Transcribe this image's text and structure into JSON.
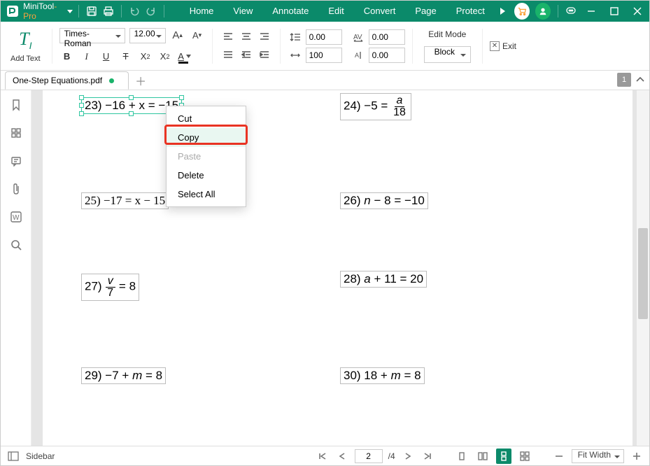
{
  "app": {
    "name_main": "MiniTool",
    "name_suffix": "-Pro"
  },
  "menu": {
    "home": "Home",
    "view": "View",
    "annotate": "Annotate",
    "edit": "Edit",
    "convert": "Convert",
    "page": "Page",
    "protect": "Protect"
  },
  "ribbon": {
    "add_text": "Add Text",
    "font_name": "Times-Roman",
    "font_size": "12.00",
    "bold": "B",
    "italic": "I",
    "underline": "U",
    "strike": "T",
    "super": "X",
    "sub": "X",
    "line_sp": "0.00",
    "char_sp": "0.00",
    "scale_h": "100",
    "scale_v": "0.00",
    "edit_mode": "Edit Mode",
    "block": "Block",
    "exit": "Exit"
  },
  "tab": {
    "filename": "One-Step Equations.pdf",
    "page_badge": "1"
  },
  "equations": {
    "q23": "23)  −16 + x = −15",
    "q24_pre": "24)  −5 = ",
    "q24_num": "a",
    "q24_den": "18",
    "q25": "25)  −17 = x − 15",
    "q26": "26)   n − 8 = −10",
    "q27_pre": "27)  ",
    "q27_num": "v",
    "q27_den": "7",
    "q27_post": " = 8",
    "q28": "28)   a + 11 = 20",
    "q29": "29)  −7 + m = 8",
    "q30": "30)   18 + m = 8"
  },
  "ctx": {
    "cut": "Cut",
    "copy": "Copy",
    "paste": "Paste",
    "delete": "Delete",
    "select_all": "Select All"
  },
  "status": {
    "sidebar": "Sidebar",
    "cur_page": "2",
    "total_pages": "/4",
    "zoom": "Fit Width"
  }
}
